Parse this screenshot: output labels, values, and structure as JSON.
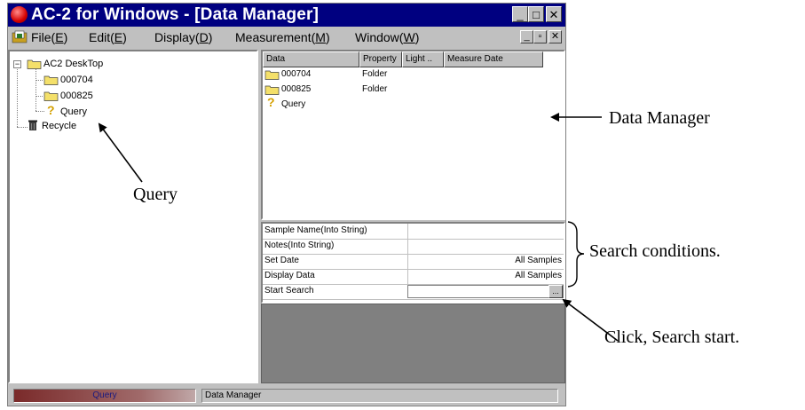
{
  "window": {
    "title": "AC-2 for Windows - [Data Manager]",
    "title_buttons": [
      "_",
      "□",
      "✕"
    ]
  },
  "menubar": {
    "items": [
      {
        "label": "File(",
        "key": "E",
        "suffix": ")"
      },
      {
        "label": "Edit(",
        "key": "E",
        "suffix": ")"
      },
      {
        "label": "Display(",
        "key": "D",
        "suffix": ")"
      },
      {
        "label": "Measurement(",
        "key": "M",
        "suffix": ")"
      },
      {
        "label": "Window(",
        "key": "W",
        "suffix": ")"
      }
    ],
    "mdi_buttons": [
      "_",
      "▫",
      "✕"
    ]
  },
  "tree": {
    "root": {
      "label": "AC2 DeskTop",
      "expander": "−"
    },
    "children": [
      {
        "label": "000704",
        "icon": "folder-icon"
      },
      {
        "label": "000825",
        "icon": "folder-icon"
      },
      {
        "label": "Query",
        "icon": "query-icon"
      }
    ],
    "recycle": {
      "label": "Recycle",
      "icon": "trash-icon"
    }
  },
  "list": {
    "columns": [
      "Data",
      "Property",
      "Light ..",
      "Measure Date"
    ],
    "rows": [
      {
        "name": "000704",
        "property": "Folder",
        "icon": "folder-icon"
      },
      {
        "name": "000825",
        "property": "Folder",
        "icon": "folder-icon"
      },
      {
        "name": "Query",
        "property": "",
        "icon": "query-icon"
      }
    ]
  },
  "search": {
    "rows": [
      {
        "label": "Sample Name(Into String)",
        "value": ""
      },
      {
        "label": "Notes(Into String)",
        "value": ""
      },
      {
        "label": "Set Date",
        "value": "All Samples"
      },
      {
        "label": "Display Data",
        "value": "All Samples"
      },
      {
        "label": "Start Search",
        "value": ""
      }
    ],
    "start_button": "..."
  },
  "status": {
    "left": "Query",
    "right": "Data Manager"
  },
  "annotations": {
    "data_manager": "Data Manager",
    "query": "Query",
    "search_conditions": "Search conditions.",
    "search_start": "Click, Search start."
  }
}
